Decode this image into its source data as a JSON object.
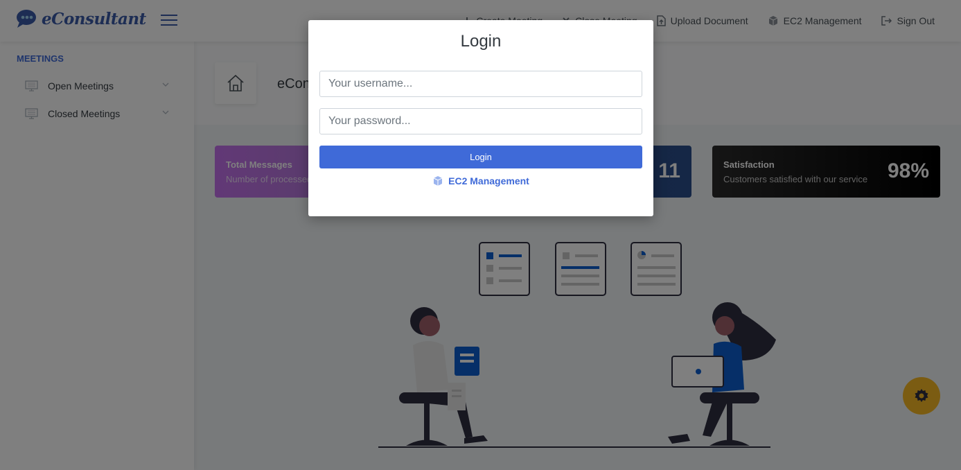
{
  "brand": {
    "name": "eConsultant"
  },
  "topnav": {
    "items": [
      {
        "label": "Create Meeting",
        "icon": "plus-icon"
      },
      {
        "label": "Close Meeting",
        "icon": "close-icon"
      },
      {
        "label": "Upload Document",
        "icon": "file-upload-icon"
      },
      {
        "label": "EC2 Management",
        "icon": "cube-icon"
      },
      {
        "label": "Sign Out",
        "icon": "sign-out-icon"
      }
    ]
  },
  "sidebar": {
    "heading": "MEETINGS",
    "items": [
      {
        "label": "Open Meetings",
        "icon": "monitor-icon"
      },
      {
        "label": "Closed Meetings",
        "icon": "monitor-icon"
      }
    ]
  },
  "main": {
    "page_title": "eConsultant",
    "cards": [
      {
        "title": "Total Messages",
        "subtitle": "Number of processed messages",
        "value": ""
      },
      {
        "title": "",
        "subtitle": "",
        "value": "11"
      },
      {
        "title": "Satisfaction",
        "subtitle": "Customers satisfied with our service",
        "value": "98%"
      }
    ]
  },
  "modal": {
    "title": "Login",
    "username_placeholder": "Your username...",
    "password_placeholder": "Your password...",
    "login_button": "Login",
    "ec2_link": "EC2 Management"
  },
  "colors": {
    "primary": "#3f6ad8",
    "brand": "#3a5ba8",
    "warning": "#f7b924",
    "overlay": "rgba(0,0,0,0.5)"
  }
}
